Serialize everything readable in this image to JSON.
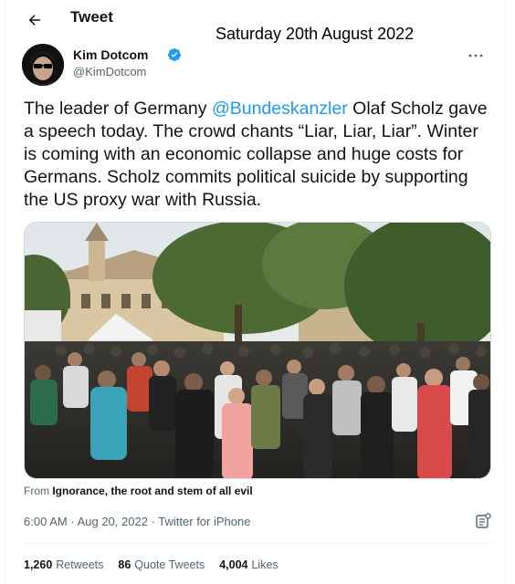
{
  "header": {
    "title": "Tweet",
    "overlay_date": "Saturday 20th August 2022"
  },
  "author": {
    "name": "Kim Dotcom",
    "handle": "@KimDotcom",
    "verified": true
  },
  "tweet": {
    "text_before": "The leader of Germany ",
    "mention": "@Bundeskanzler",
    "text_after": " Olaf Scholz gave a speech today. The crowd chants “Liar, Liar, Liar”. Winter is coming with an economic collapse and huge costs for Germans. Scholz commits political suicide by supporting the US proxy war with Russia."
  },
  "source": {
    "prefix": "From",
    "link": "Ignorance, the root and stem of all evil"
  },
  "meta": {
    "time": "6:00 AM",
    "date": "Aug 20, 2022",
    "client": "Twitter for iPhone",
    "separator": "·"
  },
  "stats": {
    "retweets_count": "1,260",
    "retweets_label": "Retweets",
    "quotes_count": "86",
    "quotes_label": "Quote Tweets",
    "likes_count": "4,004",
    "likes_label": "Likes"
  },
  "colors": {
    "accent": "#1d9bf0",
    "text": "#0f1419",
    "muted": "#536471"
  },
  "icons": [
    "back-arrow-icon",
    "verified-badge-icon",
    "more-icon",
    "analytics-icon"
  ]
}
